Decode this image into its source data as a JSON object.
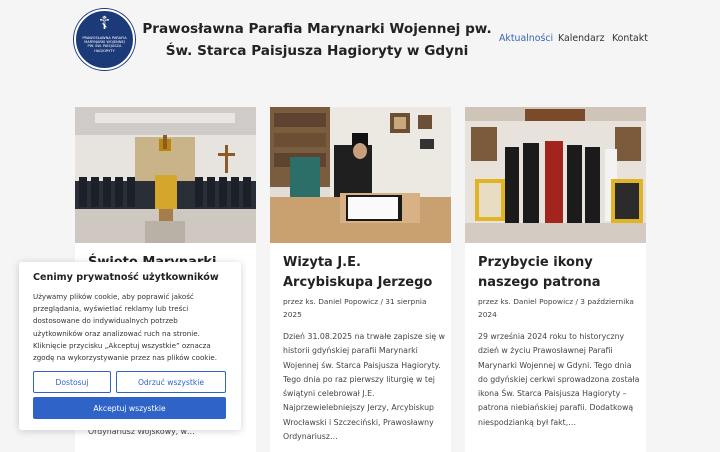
{
  "site": {
    "title": "Prawosławna Parafia Marynarki Wojennej pw. Św. Starca Paisjusza Hagioryty w Gdyni",
    "logo_text": "Prawosławna Parafia Marynarki Wojennej pw. Św. Paisjusza Hagioryty",
    "logo_icon": "orthodox-cross-icon"
  },
  "nav": {
    "items": [
      {
        "label": "Aktualności",
        "active": true
      },
      {
        "label": "Kalendarz",
        "active": false
      },
      {
        "label": "Kontakt",
        "active": false
      }
    ]
  },
  "posts": [
    {
      "title": "Święto Marynarki",
      "meta": "",
      "excerpt_tail": "Ordynariusz Wojskowy, w…"
    },
    {
      "title": "Wizyta J.E. Arcybiskupa Jerzego",
      "meta": "przez ks. Daniel Popowicz  /  31 sierpnia 2025",
      "excerpt": "Dzień 31.08.2025 na trwałe zapisze się w historii gdyńskiej parafii Marynarki Wojennej św. Starca Paisjusza Hagioryty. Tego dnia po raz pierwszy liturgię w tej świątyni celebrował J.E. Najprzewielebniejszy Jerzy, Arcybiskup Wrocławski i Szczeciński, Prawosławny Ordynariusz…"
    },
    {
      "title": "Przybycie ikony naszego patrona",
      "meta": "przez ks. Daniel Popowicz  /  3 października 2024",
      "excerpt": "29 września 2024 roku to historyczny dzień w życiu Prawosławnej Parafii Marynarki Wojennej w Gdyni. Tego dnia do gdyńskiej cerkwi sprowadzona została ikona Św. Starca Paisjusza Hagioryty – patrona niebiańskiej parafii. Dodatkową niespodzianką był fakt,…"
    }
  ],
  "cookie": {
    "title": "Cenimy prywatność użytkowników",
    "body": "Używamy plików cookie, aby poprawić jakość przeglądania, wyświetlać reklamy lub treści dostosowane do indywidualnych potrzeb użytkowników oraz analizować ruch na stronie. Kliknięcie przycisku „Akceptuj wszystkie” oznacza zgodę na wykorzystywanie przez nas plików cookie.",
    "customize_label": "Dostosuj",
    "reject_label": "Odrzuć wszystkie",
    "accept_label": "Akceptuj wszystkie"
  },
  "colors": {
    "accent": "#2f63c7",
    "nav_active": "#3a64b6",
    "logo_bg": "#1d3a78"
  }
}
